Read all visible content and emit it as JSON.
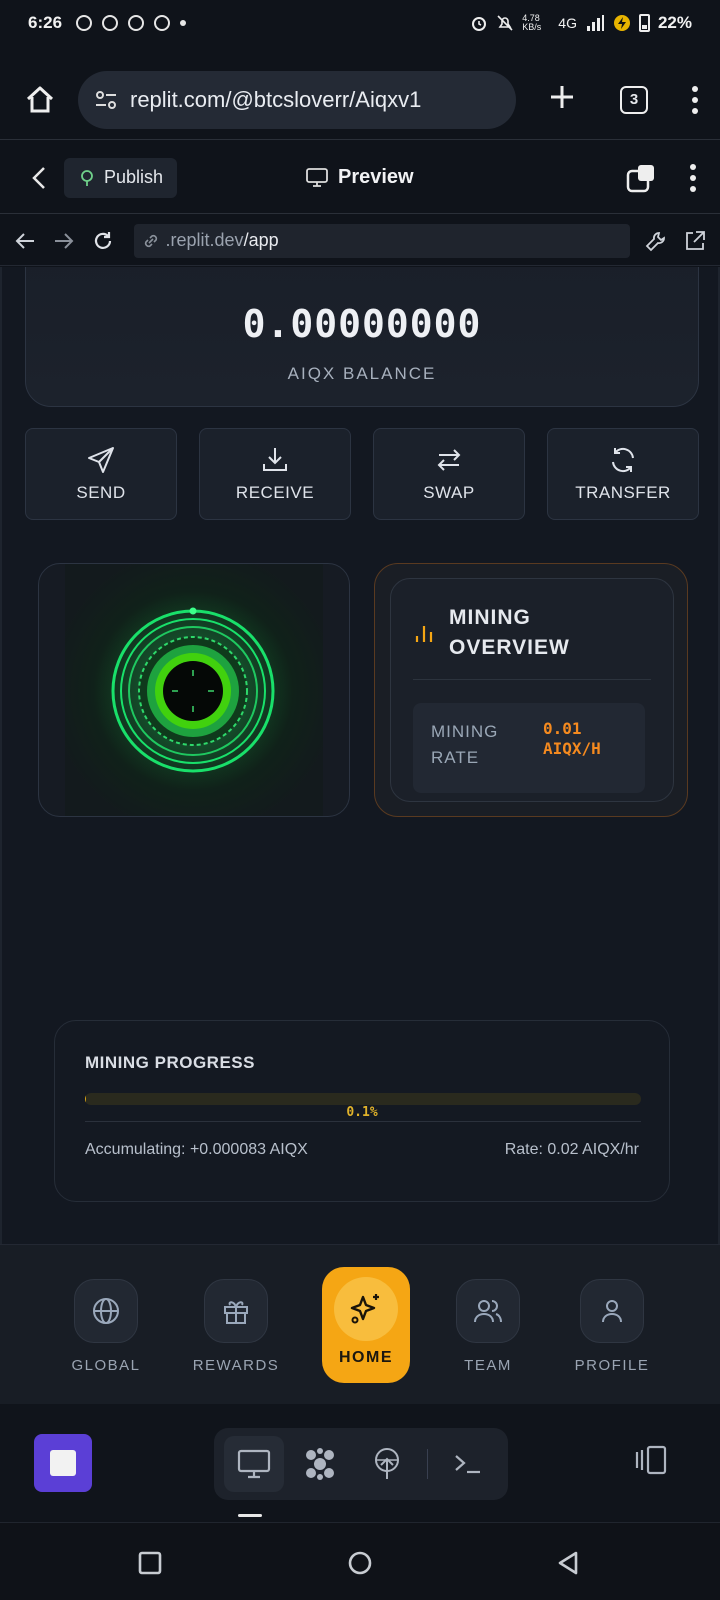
{
  "status_bar": {
    "time": "6:26",
    "network": "4G",
    "data_speed": "4.78 KB/s",
    "battery": "22%"
  },
  "browser": {
    "url": "replit.com/@btcsloverr/Aiqxv1",
    "tab_count": "3"
  },
  "replit_header": {
    "publish_label": "Publish",
    "title": "Preview"
  },
  "webview": {
    "address_domain": ".replit.dev",
    "address_path": "/app"
  },
  "wallet": {
    "balance": "0.00000000",
    "balance_label": "AIQX BALANCE",
    "actions": [
      {
        "label": "SEND",
        "icon": "send-icon"
      },
      {
        "label": "RECEIVE",
        "icon": "download-icon"
      },
      {
        "label": "SWAP",
        "icon": "swap-icon"
      },
      {
        "label": "TRANSFER",
        "icon": "refresh-icon"
      }
    ]
  },
  "mining_overview": {
    "title": "MINING OVERVIEW",
    "rate_label": "MINING RATE",
    "rate_value": "0.01 AIQX/H"
  },
  "mining_progress": {
    "title": "MINING PROGRESS",
    "percent": 0.1,
    "percent_label": "0.1%",
    "accumulating": "Accumulating: +0.000083 AIQX",
    "rate": "Rate: 0.02 AIQX/hr"
  },
  "bottom_nav": {
    "items": [
      {
        "label": "GLOBAL",
        "icon": "globe-icon"
      },
      {
        "label": "REWARDS",
        "icon": "gift-icon"
      },
      {
        "label": "HOME",
        "icon": "sparkles-icon",
        "active": true
      },
      {
        "label": "TEAM",
        "icon": "users-icon"
      },
      {
        "label": "PROFILE",
        "icon": "user-icon"
      }
    ]
  },
  "colors": {
    "accent": "#f5a614",
    "rate_orange": "#f58a1f",
    "orb_green": "#19e06a",
    "replit_purple": "#5b3fd6"
  }
}
